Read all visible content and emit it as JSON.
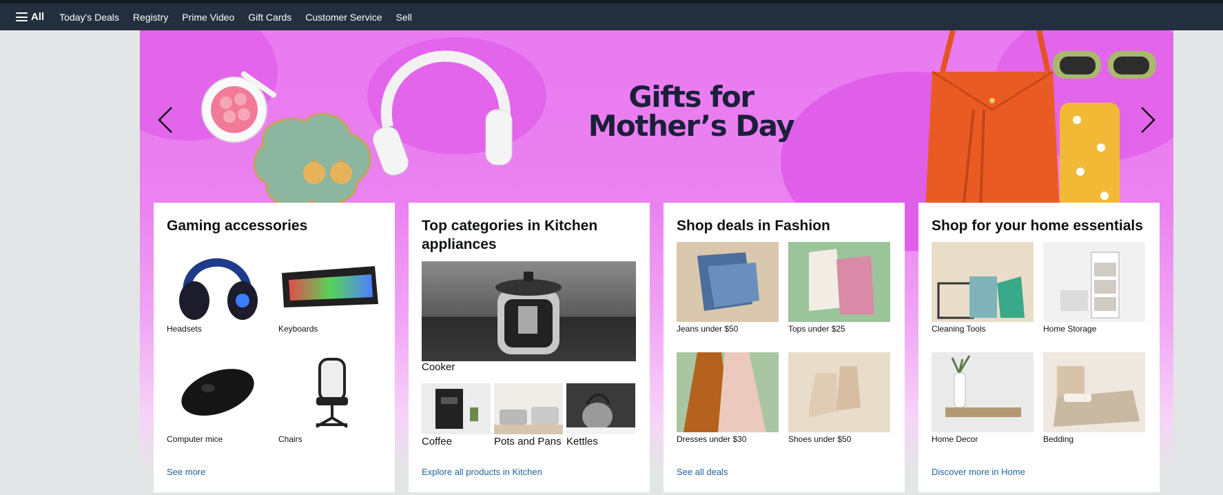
{
  "nav": {
    "all_label": "All",
    "links": [
      "Today's Deals",
      "Registry",
      "Prime Video",
      "Gift Cards",
      "Customer Service",
      "Sell"
    ]
  },
  "hero": {
    "title_line1": "Gifts for",
    "title_line2": "Mother’s Day"
  },
  "cards": [
    {
      "title": "Gaming accessories",
      "items": [
        "Headsets",
        "Keyboards",
        "Computer mice",
        "Chairs"
      ],
      "link": "See more"
    },
    {
      "title": "Top categories in Kitchen appliances",
      "main_item": "Cooker",
      "items": [
        "Coffee",
        "Pots and Pans",
        "Kettles"
      ],
      "link": "Explore all products in Kitchen"
    },
    {
      "title": "Shop deals in Fashion",
      "items": [
        "Jeans under $50",
        "Tops under $25",
        "Dresses under $30",
        "Shoes under $50"
      ],
      "link": "See all deals"
    },
    {
      "title": "Shop for your home essentials",
      "items": [
        "Cleaning Tools",
        "Home Storage",
        "Home Decor",
        "Bedding"
      ],
      "link": "Discover more in Home"
    }
  ],
  "colors": {
    "nav_bg": "#232f3e",
    "hero_pink": "#e97bf0",
    "link_blue": "#2162a1"
  },
  "icons": [
    "menu-icon",
    "chevron-left-icon",
    "chevron-right-icon"
  ]
}
